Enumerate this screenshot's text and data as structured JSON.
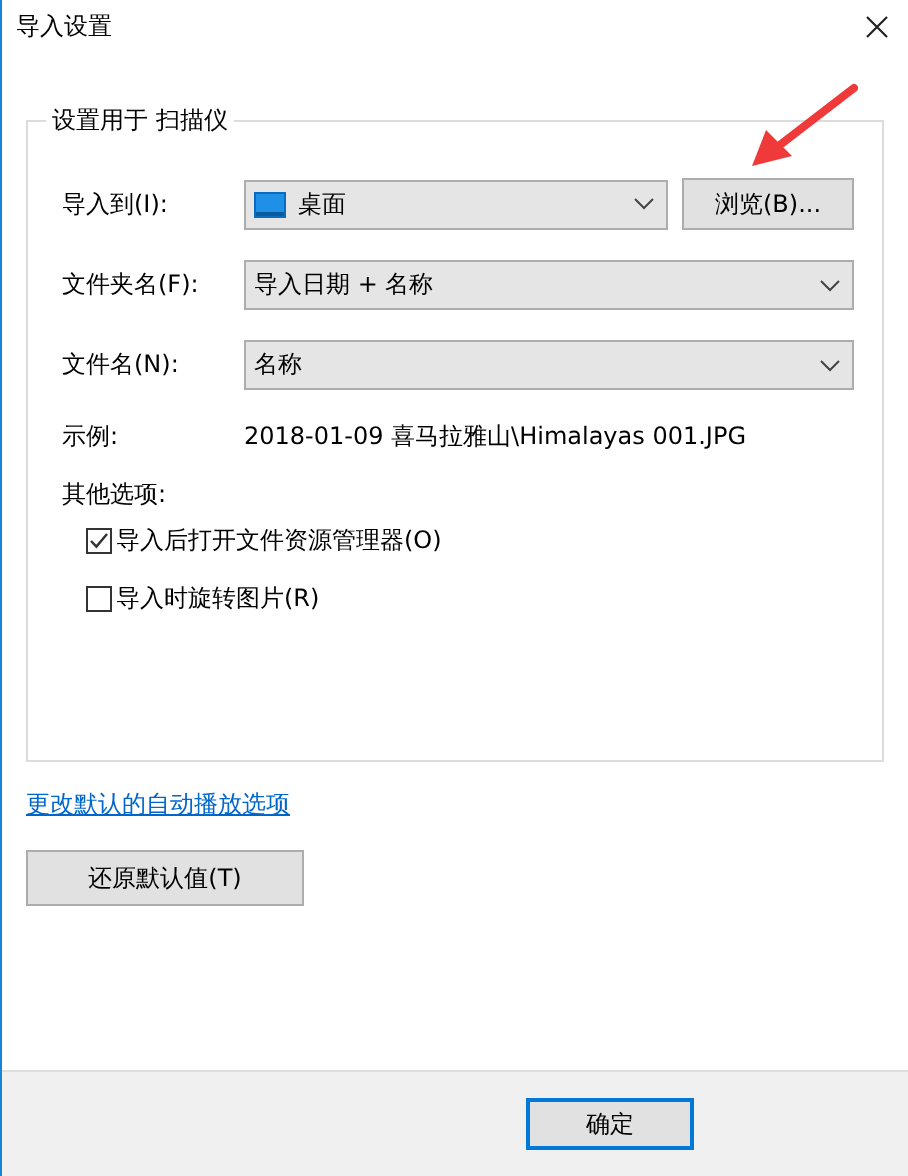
{
  "window": {
    "title": "导入设置"
  },
  "group": {
    "legend": "设置用于 扫描仪"
  },
  "fields": [
    {
      "label": "导入到(I):",
      "value": "桌面",
      "kind": "folder"
    },
    {
      "label": "文件夹名(F):",
      "value": "导入日期 + 名称",
      "kind": "plain"
    },
    {
      "label": "文件名(N):",
      "value": "名称",
      "kind": "plain"
    }
  ],
  "browse_button": "浏览(B)...",
  "example": {
    "label": "示例:",
    "value": "2018-01-09 喜马拉雅山\\Himalayas 001.JPG"
  },
  "options_heading": "其他选项:",
  "options": [
    {
      "label": "导入后打开文件资源管理器(O)",
      "checked": true
    },
    {
      "label": "导入时旋转图片(R)",
      "checked": false
    }
  ],
  "link": "更改默认的自动播放选项",
  "restore_button": "还原默认值(T)",
  "ok_button": "确定"
}
